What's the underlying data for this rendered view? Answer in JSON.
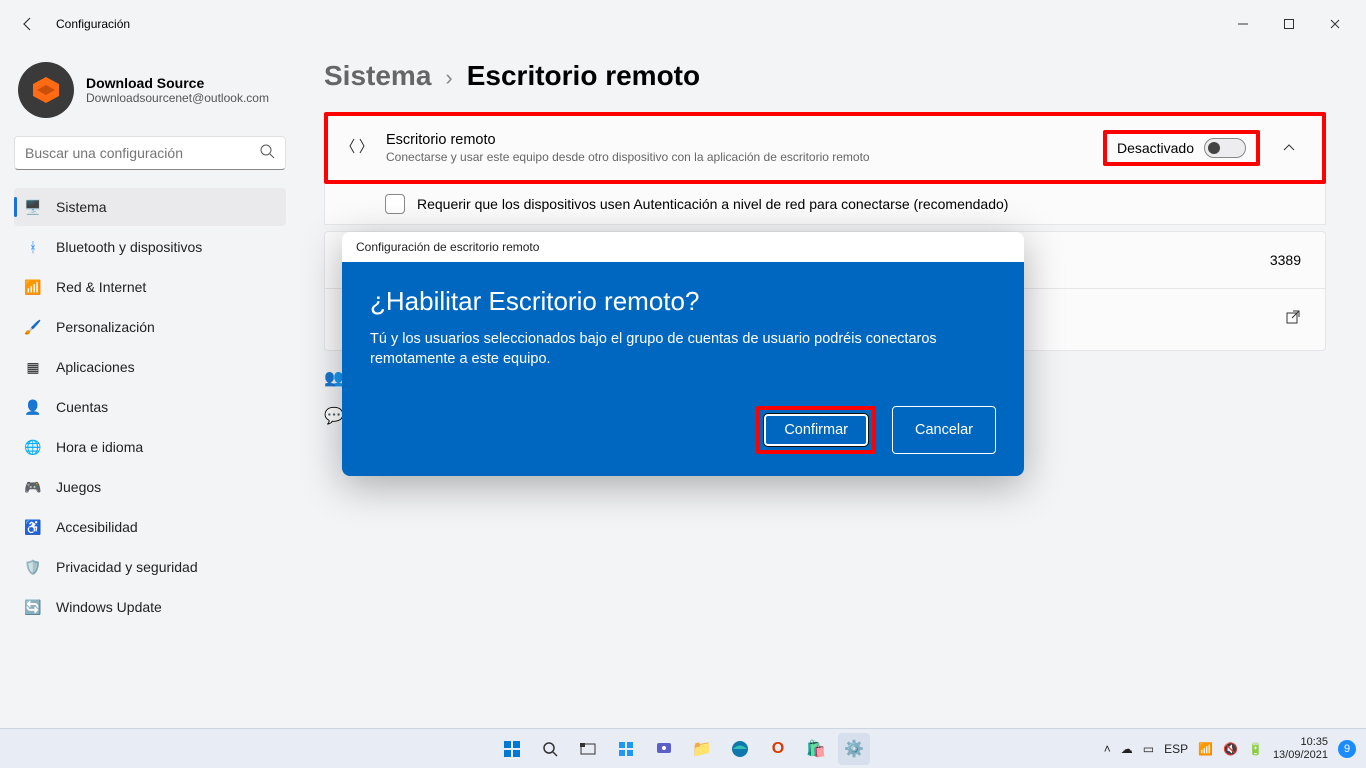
{
  "window": {
    "title": "Configuración"
  },
  "profile": {
    "name": "Download Source",
    "email": "Downloadsourcenet@outlook.com"
  },
  "search": {
    "placeholder": "Buscar una configuración"
  },
  "nav": {
    "items": [
      {
        "label": "Sistema"
      },
      {
        "label": "Bluetooth y dispositivos"
      },
      {
        "label": "Red & Internet"
      },
      {
        "label": "Personalización"
      },
      {
        "label": "Aplicaciones"
      },
      {
        "label": "Cuentas"
      },
      {
        "label": "Hora e idioma"
      },
      {
        "label": "Juegos"
      },
      {
        "label": "Accesibilidad"
      },
      {
        "label": "Privacidad y seguridad"
      },
      {
        "label": "Windows Update"
      }
    ]
  },
  "breadcrumb": {
    "parent": "Sistema",
    "sep": "›",
    "current": "Escritorio remoto"
  },
  "remote": {
    "title": "Escritorio remoto",
    "subtitle": "Conectarse y usar este equipo desde otro dispositivo con la aplicación de escritorio remoto",
    "state_label": "Desactivado",
    "nla_label": "Requerir que los dispositivos usen Autenticación a nivel de red para conectarse (recomendado)",
    "port_value": "3389"
  },
  "dialog": {
    "header": "Configuración de escritorio remoto",
    "title": "¿Habilitar Escritorio remoto?",
    "text": "Tú y los usuarios seleccionados bajo el grupo de cuentas de usuario podréis conectaros remotamente a este equipo.",
    "confirm": "Confirmar",
    "cancel": "Cancelar"
  },
  "taskbar": {
    "lang": "ESP",
    "time": "10:35",
    "date": "13/09/2021",
    "badge": "9"
  },
  "colors": {
    "accent": "#0067c0",
    "highlight": "#ff0000"
  }
}
